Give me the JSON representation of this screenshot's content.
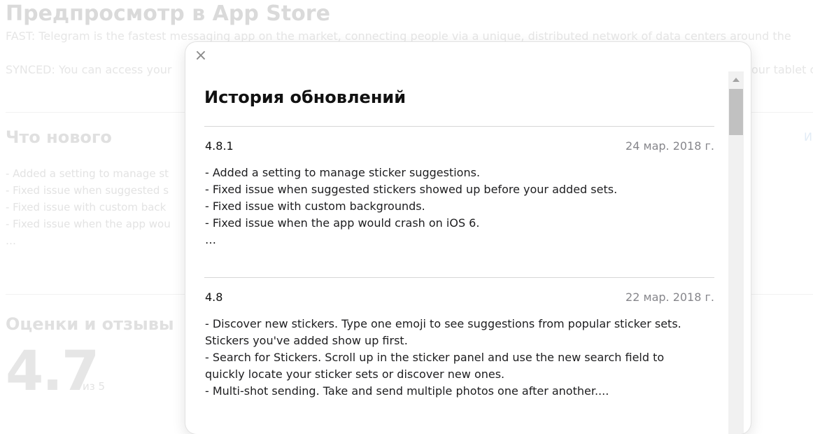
{
  "background": {
    "title": "Предпросмотр в App Store",
    "desc_line1": "FAST: Telegram is the fastest messaging app on the market, connecting people via a unique, distributed network of data centers around the",
    "desc_line2": "SYNCED: You can access your",
    "desc_line2_tail": "our tablet c",
    "whats_new_heading": "Что нового",
    "version_history_link": "И",
    "whats_new_items": [
      "- Added a setting to manage st",
      "- Fixed issue when suggested s",
      "- Fixed issue with custom back",
      "- Fixed issue when the app wou",
      "…"
    ],
    "ratings_heading": "Оценки и отзывы",
    "rating_value": "4.7",
    "rating_out_of": "из 5"
  },
  "modal": {
    "close_icon": "close-icon",
    "close_glyph": "×",
    "title": "История обновлений",
    "entries": [
      {
        "version": "4.8.1",
        "date": "24 мар. 2018 г.",
        "notes": [
          "- Added a setting to manage sticker suggestions.",
          "- Fixed issue when suggested stickers showed up before your added sets.",
          "- Fixed issue with custom backgrounds.",
          "- Fixed issue when the app would crash on iOS 6.",
          "…"
        ]
      },
      {
        "version": "4.8",
        "date": "22 мар. 2018 г.",
        "notes": [
          "- Discover new stickers. Type one emoji to see suggestions from popular sticker sets.",
          "Stickers you've added show up first.",
          "- Search for Stickers. Scroll up in the sticker panel and use the new search field to",
          "quickly locate your sticker sets or discover new ones.",
          "- Multi-shot sending. Take and send multiple photos one after another...."
        ]
      }
    ]
  }
}
